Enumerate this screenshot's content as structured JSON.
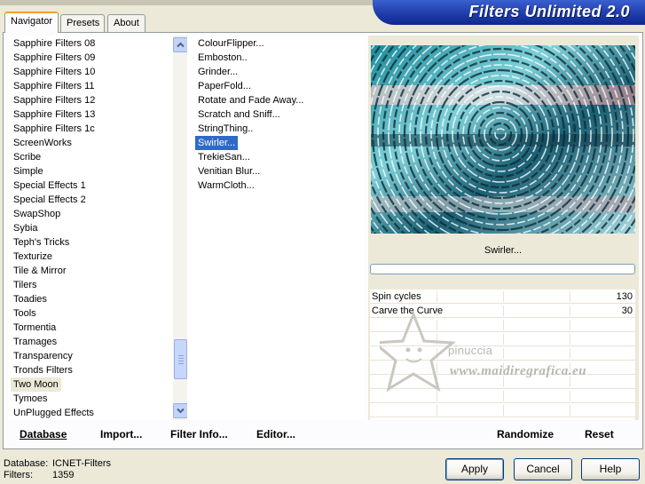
{
  "banner": {
    "title": "Filters Unlimited 2.0"
  },
  "tabs": [
    {
      "label": "Navigator",
      "active": true
    },
    {
      "label": "Presets",
      "active": false
    },
    {
      "label": "About",
      "active": false
    }
  ],
  "categories": [
    "Sapphire Filters 08",
    "Sapphire Filters 09",
    "Sapphire Filters 10",
    "Sapphire Filters 11",
    "Sapphire Filters 12",
    "Sapphire Filters 13",
    "Sapphire Filters 1c",
    "ScreenWorks",
    "Scribe",
    "Simple",
    "Special Effects 1",
    "Special Effects 2",
    "SwapShop",
    "Sybia",
    "Teph's Tricks",
    "Texturize",
    "Tile & Mirror",
    "Tilers",
    "Toadies",
    "Tools",
    "Tormentia",
    "Tramages",
    "Transparency",
    "Tronds Filters",
    "Two Moon",
    "Tymoes",
    "UnPlugged Effects"
  ],
  "selected_category": "Two Moon",
  "filters": [
    "ColourFlipper...",
    "Emboston..",
    "Grinder...",
    "PaperFold...",
    "Rotate and Fade Away...",
    "Scratch and Sniff...",
    "StringThing..",
    "Swirler...",
    "TrekieSan...",
    "Venitian Blur...",
    "WarmCloth..."
  ],
  "selected_filter": "Swirler...",
  "filter_name": "Swirler...",
  "params": [
    {
      "label": "Spin cycles",
      "value": "130"
    },
    {
      "label": "Carve the Curve",
      "value": "30"
    }
  ],
  "watermark": {
    "line1": "pinuccia",
    "line2": "www.maidiregrafica.eu"
  },
  "bottom_buttons": {
    "database": "Database",
    "import": "Import...",
    "filter_info": "Filter Info...",
    "editor": "Editor...",
    "randomize": "Randomize",
    "reset": "Reset"
  },
  "status": {
    "database_label": "Database:",
    "database_value": "ICNET-Filters",
    "filters_label": "Filters:",
    "filters_value": "1359"
  },
  "dialog_buttons": {
    "apply": "Apply",
    "cancel": "Cancel",
    "help": "Help"
  },
  "colors": {
    "banner": "#1d3aa8",
    "selection": "#316ac5",
    "face": "#ece9d8"
  },
  "icons": {
    "scroll_up": "chevron-up-icon",
    "scroll_down": "chevron-down-icon"
  }
}
